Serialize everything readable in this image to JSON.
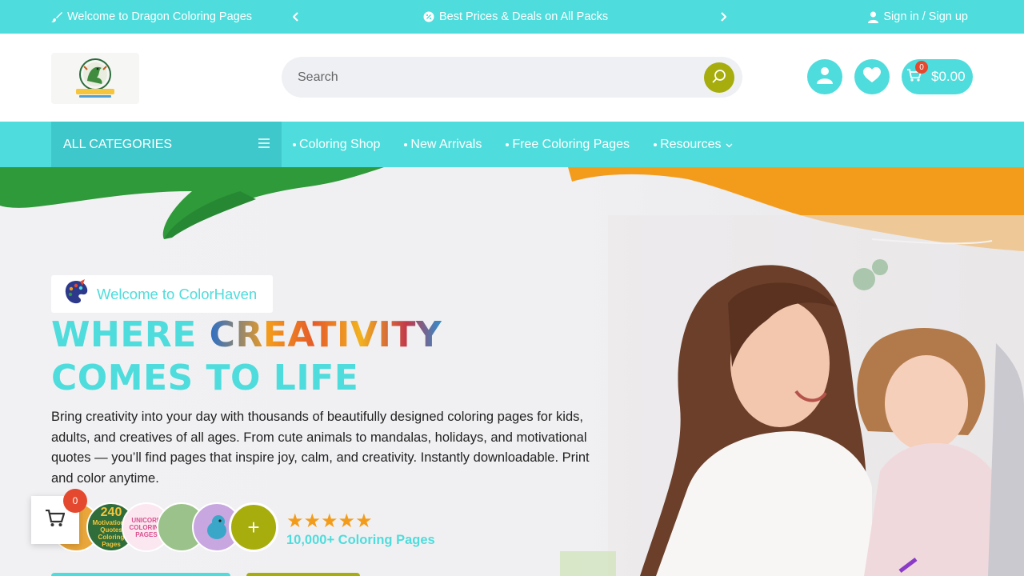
{
  "topbar": {
    "welcome": "Welcome to Dragon Coloring Pages",
    "deal": "Best Prices & Deals on All Packs",
    "signin": "Sign in / Sign up"
  },
  "header": {
    "logo_alt": "Dragon Coloring Pages logo",
    "search_placeholder": "Search",
    "cart_count": "0",
    "cart_total": "$0.00"
  },
  "nav": {
    "all_categories": "ALL CATEGORIES",
    "links": [
      "Coloring Shop",
      "New Arrivals",
      "Free Coloring Pages",
      "Resources"
    ]
  },
  "hero": {
    "badge": "Welcome to ColorHaven",
    "headline_part1": "WHERE ",
    "headline_highlight": "CREATIVITY",
    "headline_line2": "COMES TO LIFE",
    "description": "Bring creativity into your day with thousands of beautifully designed coloring pages for kids, adults, and creatives of all ages. From cute animals to mandalas, holidays, and motivational quotes — you’ll find pages that inspire joy, calm, and creativity. Instantly downloadable. Print and color anytime.",
    "thumb_labels": [
      "240",
      "Motivational Quotes Coloring Pages",
      "UNICORN COLORING PAGES"
    ],
    "plus": "+",
    "stars": "★★★★★",
    "rating_value": 5,
    "pages_count": "10,000+ Coloring Pages"
  },
  "floating_cart": {
    "count": "0"
  },
  "colors": {
    "brand_cyan": "#4fdcdc",
    "accent_olive": "#a6ad0d",
    "badge_red": "#e4492f",
    "paint_green": "#2f9a3a",
    "paint_orange": "#f39c1c"
  },
  "icons": [
    "brush-icon",
    "chevron-left-icon",
    "discount-icon",
    "chevron-right-icon",
    "user-icon",
    "search-icon",
    "heart-icon",
    "cart-icon",
    "menu-icon",
    "chevron-down-icon",
    "palette-icon",
    "plus-icon"
  ]
}
